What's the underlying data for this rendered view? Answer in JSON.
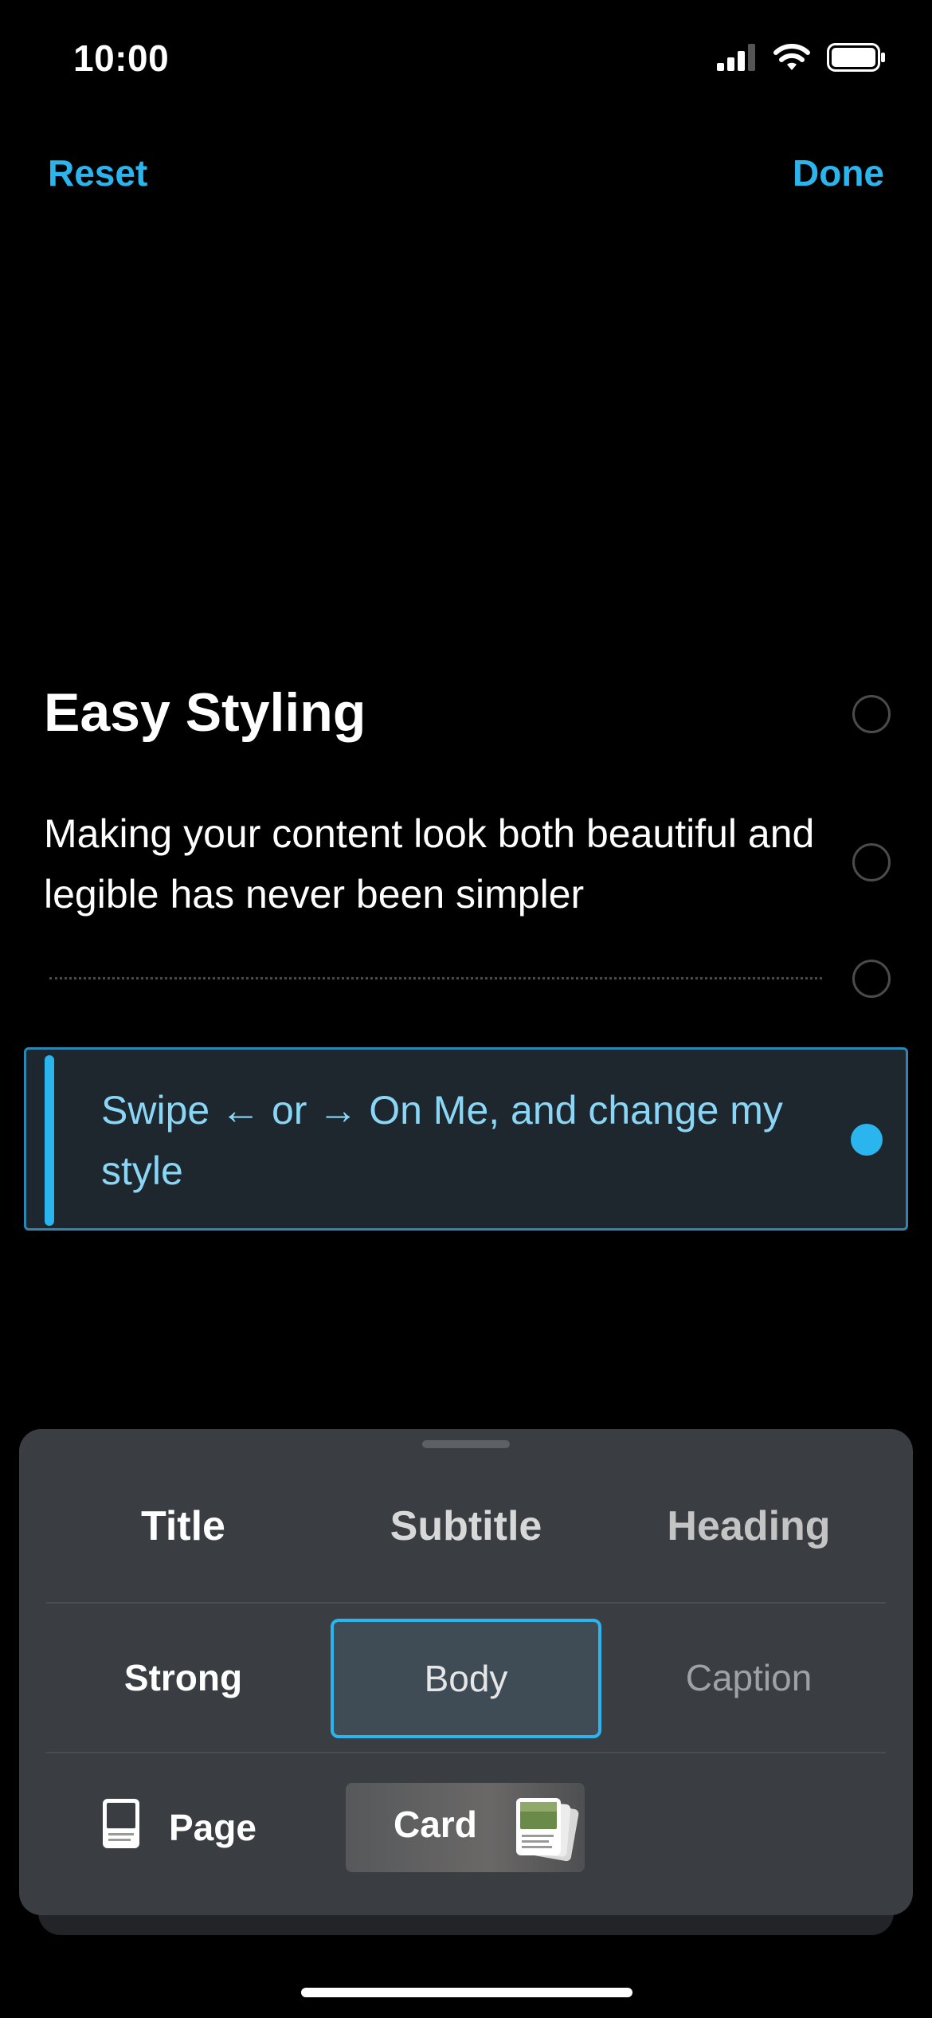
{
  "status_bar": {
    "time": "10:00",
    "icons": [
      "signal-icon",
      "wifi-icon",
      "battery-icon"
    ]
  },
  "nav": {
    "reset_label": "Reset",
    "done_label": "Done"
  },
  "content": {
    "title": "Easy Styling",
    "body": "Making your content look both beautiful and legible has never been simpler",
    "selected_block": "Swipe ← or → On Me, and change my style"
  },
  "style_picker": {
    "row1": [
      "Title",
      "Subtitle",
      "Heading"
    ],
    "row2": [
      "Strong",
      "Body",
      "Caption"
    ],
    "selected": "Body",
    "layout_options": {
      "page": "Page",
      "card": "Card"
    }
  },
  "colors": {
    "accent": "#2bb5ee",
    "panel": "#3a3d42",
    "background": "#000000"
  }
}
